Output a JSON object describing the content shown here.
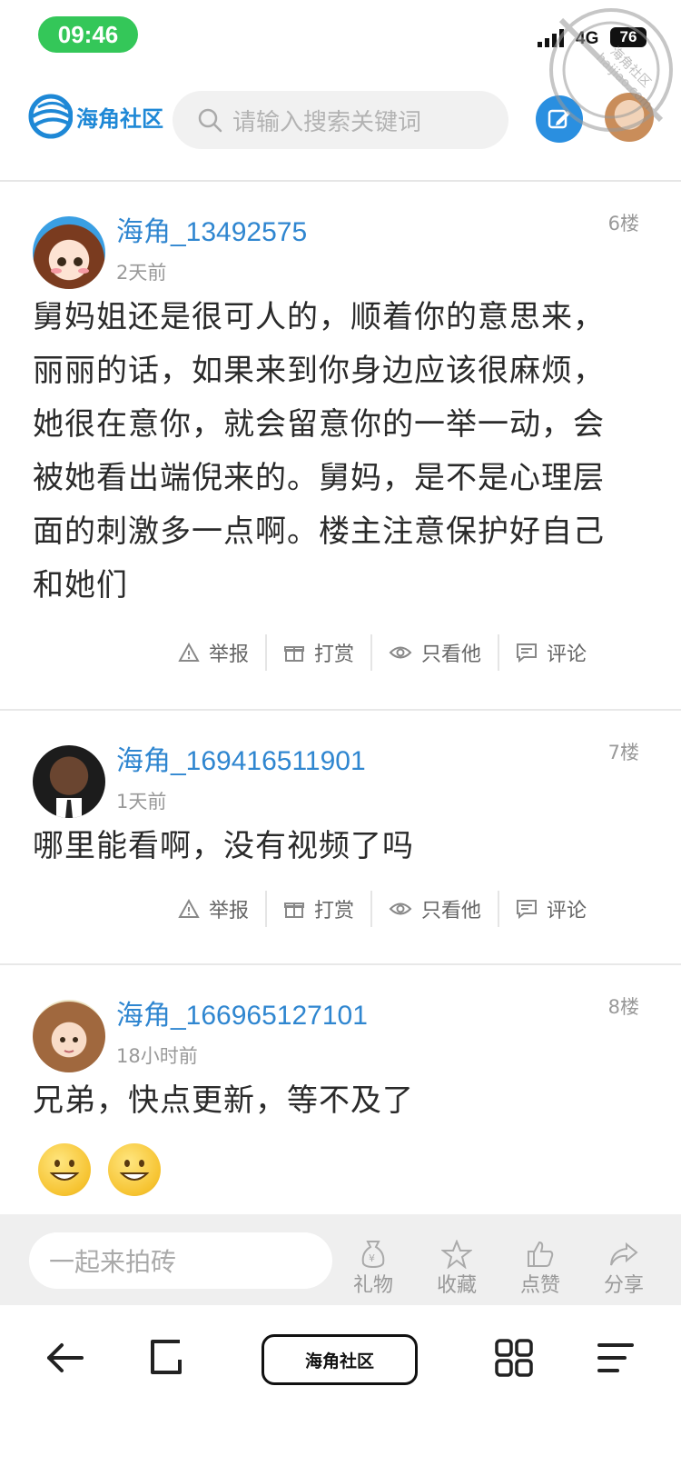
{
  "status_bar": {
    "time": "09:46",
    "network": "4G",
    "battery": "76"
  },
  "header": {
    "logo_text": "海角社区",
    "search_placeholder": "请输入搜索关键词",
    "watermark_text": "haijiao.com",
    "watermark_cn": "海角社区",
    "accent_color": "#2a8fe0"
  },
  "posts": [
    {
      "username": "海角_13492575",
      "time": "2天前",
      "floor": "6楼",
      "content": "舅妈姐还是很可人的，顺着你的意思来，丽丽的话，如果来到你身边应该很麻烦，她很在意你，就会留意你的一举一动，会被她看出端倪来的。舅妈，是不是心理层面的刺激多一点啊。楼主注意保护好自己和她们"
    },
    {
      "username": "海角_169416511901",
      "time": "1天前",
      "floor": "7楼",
      "content": "哪里能看啊，没有视频了吗"
    },
    {
      "username": "海角_166965127101",
      "time": "18小时前",
      "floor": "8楼",
      "content": "兄弟，快点更新，等不及了"
    }
  ],
  "actions": {
    "report": "举报",
    "reward": "打赏",
    "only_him": "只看他",
    "comment": "评论"
  },
  "comment_bar": {
    "placeholder": "一起来拍砖",
    "gift": "礼物",
    "favorite": "收藏",
    "like": "点赞",
    "share": "分享"
  },
  "browser": {
    "site_label": "海角社区"
  }
}
